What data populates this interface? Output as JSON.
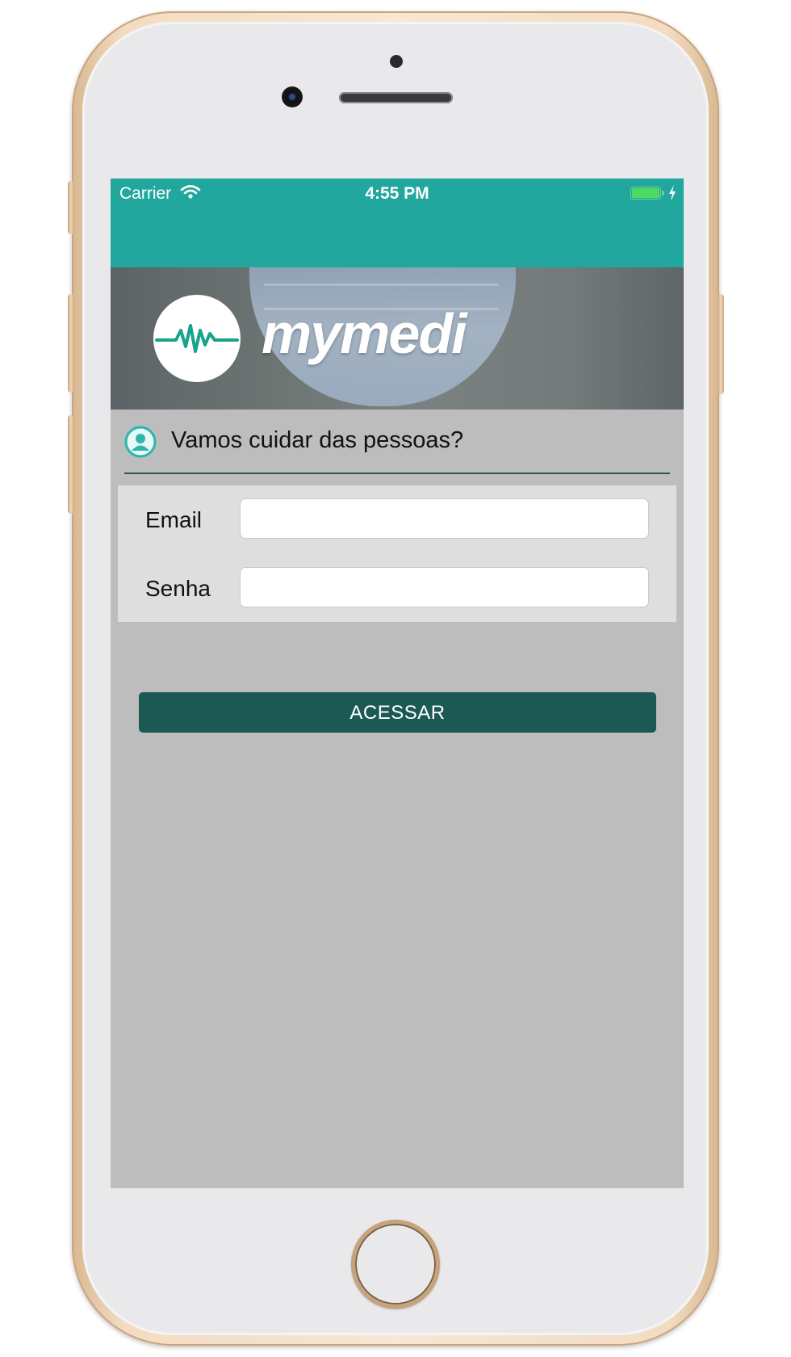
{
  "status_bar": {
    "carrier": "Carrier",
    "time": "4:55 PM",
    "wifi_icon": "wifi-icon",
    "battery_icon": "battery-icon",
    "charging_icon": "charging-icon",
    "color": "#21a79e"
  },
  "banner": {
    "logo_text": "mymedi",
    "logo_icon": "heartbeat-icon"
  },
  "welcome": {
    "icon": "user-icon",
    "text": "Vamos cuidar das pessoas?"
  },
  "form": {
    "email_label": "Email",
    "email_value": "",
    "password_label": "Senha",
    "password_value": ""
  },
  "actions": {
    "access_label": "ACESSAR",
    "button_color": "#1c5955"
  },
  "colors": {
    "accent": "#21a79e",
    "background": "#bdbdbd",
    "panel": "#dedede"
  }
}
